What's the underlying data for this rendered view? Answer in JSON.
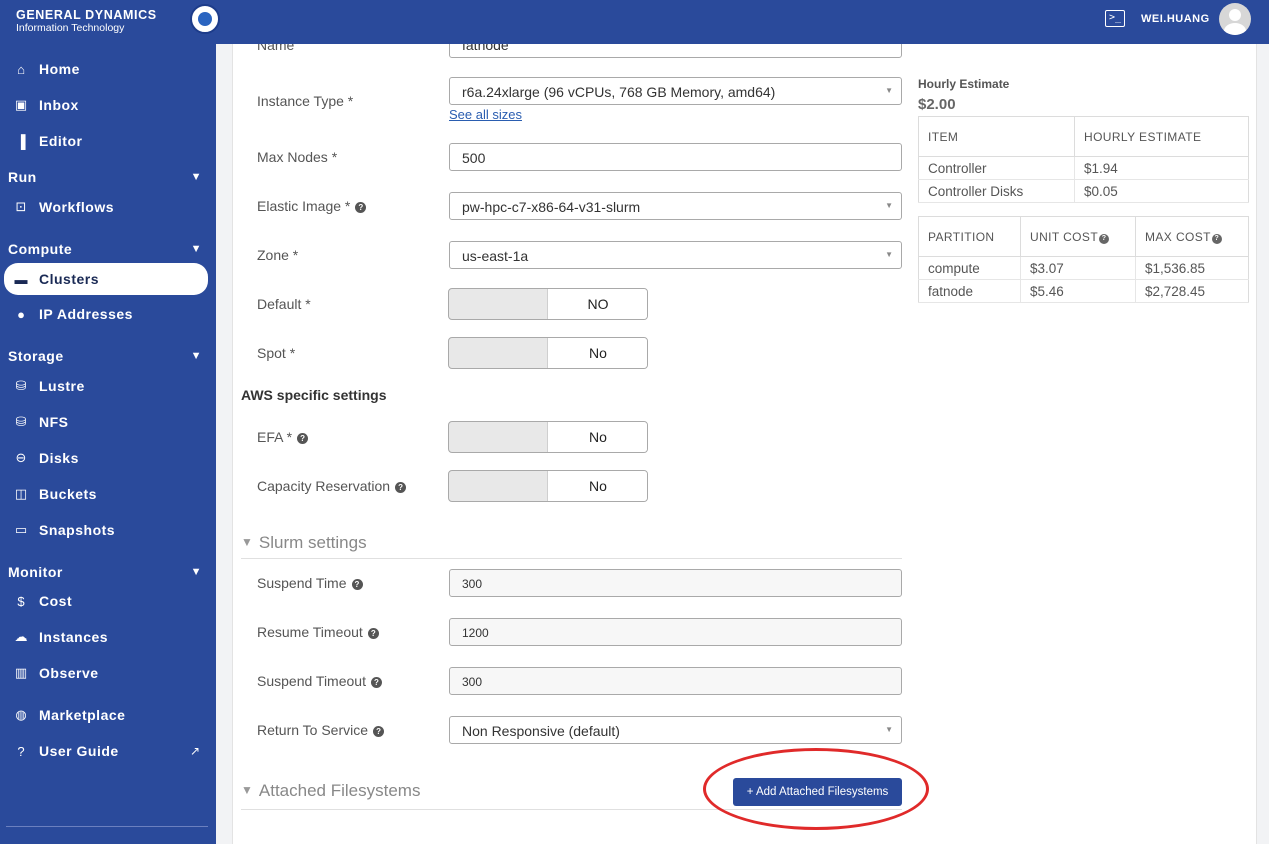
{
  "brand": {
    "name": "GENERAL DYNAMICS",
    "subtitle": "Information Technology"
  },
  "topbar": {
    "username": "WEI.HUANG",
    "terminal_glyph": ">_"
  },
  "sidebar": {
    "items": {
      "home": "Home",
      "inbox": "Inbox",
      "editor": "Editor",
      "workflows": "Workflows",
      "clusters": "Clusters",
      "ip_addresses": "IP Addresses",
      "lustre": "Lustre",
      "nfs": "NFS",
      "disks": "Disks",
      "buckets": "Buckets",
      "snapshots": "Snapshots",
      "cost": "Cost",
      "instances": "Instances",
      "observe": "Observe",
      "marketplace": "Marketplace",
      "user_guide": "User Guide"
    },
    "sections": {
      "run": "Run",
      "compute": "Compute",
      "storage": "Storage",
      "monitor": "Monitor"
    },
    "active": "clusters"
  },
  "form": {
    "name": {
      "label": "Name",
      "value": "fatnode"
    },
    "instance_type": {
      "label": "Instance Type *",
      "value": "r6a.24xlarge (96 vCPUs, 768 GB Memory, amd64)",
      "link": "See all sizes"
    },
    "max_nodes": {
      "label": "Max Nodes *",
      "value": "500"
    },
    "elastic_image": {
      "label": "Elastic Image *",
      "value": "pw-hpc-c7-x86-64-v31-slurm"
    },
    "zone": {
      "label": "Zone *",
      "value": "us-east-1a"
    },
    "default": {
      "label": "Default *",
      "value": "NO"
    },
    "spot": {
      "label": "Spot *",
      "value": "No"
    },
    "aws_heading": "AWS specific settings",
    "efa": {
      "label": "EFA *",
      "value": "No"
    },
    "capacity_reservation": {
      "label": "Capacity Reservation",
      "value": "No"
    },
    "slurm_heading": "Slurm settings",
    "suspend_time": {
      "label": "Suspend Time",
      "value": "300"
    },
    "resume_timeout": {
      "label": "Resume Timeout",
      "value": "1200"
    },
    "suspend_timeout": {
      "label": "Suspend Timeout",
      "value": "300"
    },
    "return_to_service": {
      "label": "Return To Service",
      "value": "Non Responsive (default)"
    },
    "filesystems_heading": "Attached Filesystems",
    "add_filesystems_button": "+ Add Attached Filesystems"
  },
  "estimate": {
    "title": "Hourly Estimate",
    "total": "$2.00",
    "items_table": {
      "headers": [
        "ITEM",
        "HOURLY ESTIMATE"
      ],
      "rows": [
        [
          "Controller",
          "$1.94"
        ],
        [
          "Controller Disks",
          "$0.05"
        ]
      ]
    },
    "partition_table": {
      "headers": [
        "PARTITION",
        "UNIT COST",
        "MAX COST"
      ],
      "rows": [
        [
          "compute",
          "$3.07",
          "$1,536.85"
        ],
        [
          "fatnode",
          "$5.46",
          "$2,728.45"
        ]
      ]
    }
  },
  "colors": {
    "brand_blue": "#2a4a9b",
    "annotation_red": "#e02a2a"
  },
  "annotation": "red-ellipse-around-add-attached-filesystems-button"
}
